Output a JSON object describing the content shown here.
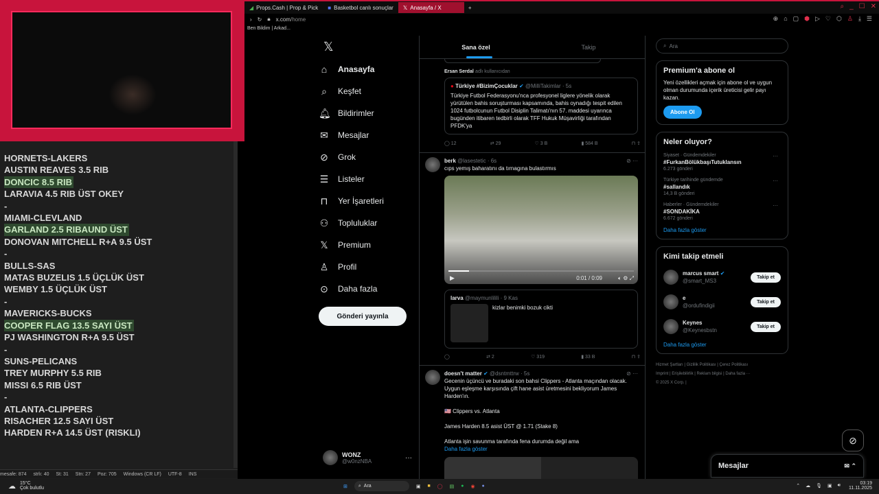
{
  "notes": {
    "lines": [
      {
        "text": "HORNETS-LAKERS",
        "hl": false
      },
      {
        "text": "AUSTIN REAVES 3.5 RIB",
        "hl": false
      },
      {
        "text": "DONCIC 8.5 RIB",
        "hl": true
      },
      {
        "text": "LARAVIA 4.5 RIB  ÜST OKEY",
        "hl": false
      },
      {
        "text": "-",
        "hl": false
      },
      {
        "text": "MIAMI-CLEVLAND",
        "hl": false
      },
      {
        "text": "GARLAND 2.5 RIBAUND ÜST",
        "hl": true
      },
      {
        "text": "DONOVAN MITCHELL R+A 9.5 ÜST",
        "hl": false
      },
      {
        "text": "-",
        "hl": false
      },
      {
        "text": "BULLS-SAS",
        "hl": false
      },
      {
        "text": "MATAS BUZELIS 1.5 ÜÇLÜK ÜST",
        "hl": false
      },
      {
        "text": "WEMBY 1.5 ÜÇLÜK ÜST",
        "hl": false
      },
      {
        "text": "-",
        "hl": false
      },
      {
        "text": "MAVERICKS-BUCKS",
        "hl": false
      },
      {
        "text": "COOPER FLAG 13.5 SAYI ÜST",
        "hl": true
      },
      {
        "text": "PJ WASHINGTON R+A 9.5 ÜST",
        "hl": false
      },
      {
        "text": "-",
        "hl": false
      },
      {
        "text": "SUNS-PELICANS",
        "hl": false
      },
      {
        "text": "TREY MURPHY 5.5 RIB",
        "hl": false
      },
      {
        "text": "MISSI 6.5 RIB ÜST",
        "hl": false
      },
      {
        "text": "-",
        "hl": false
      },
      {
        "text": "ATLANTA-CLIPPERS",
        "hl": false
      },
      {
        "text": "RISACHER 12.5 SAYI ÜST",
        "hl": false
      },
      {
        "text": "HARDEN R+A 14.5 ÜST (RISKLI)",
        "hl": false
      }
    ],
    "status": [
      "mesafe: 874",
      "strlı: 40",
      "St: 31",
      "Stn: 27",
      "Poz: 705",
      "Windows (CR LF)",
      "UTF-8",
      "INS"
    ]
  },
  "browser": {
    "tabs": [
      "Props.Cash | Prop & Pick",
      "Basketbol canlı sonuçlar",
      "Anasayfa / X"
    ],
    "url_host": "x.com",
    "url_path": "/home",
    "bookmarks": "Ben Bildim | Arkad..."
  },
  "nav": [
    {
      "icon": "home",
      "label": "Anasayfa"
    },
    {
      "icon": "search",
      "label": "Keşfet"
    },
    {
      "icon": "bell",
      "label": "Bildirimler"
    },
    {
      "icon": "mail",
      "label": "Mesajlar"
    },
    {
      "icon": "grok",
      "label": "Grok"
    },
    {
      "icon": "list",
      "label": "Listeler"
    },
    {
      "icon": "bookmark",
      "label": "Yer İşaretleri"
    },
    {
      "icon": "people",
      "label": "Topluluklar"
    },
    {
      "icon": "x",
      "label": "Premium"
    },
    {
      "icon": "person",
      "label": "Profil"
    },
    {
      "icon": "more",
      "label": "Daha fazla"
    }
  ],
  "post_button": "Gönderi yayınla",
  "me": {
    "name": "WONZ",
    "handle": "@w0nzNBA"
  },
  "feed": {
    "tabs": [
      "Sana özel",
      "Takip"
    ],
    "post1": {
      "repost_by": "Ersan Serdal",
      "repost_suffix": "adlı kullanıcıdan",
      "q_name": "Türkiye #BizimÇocuklar",
      "q_handle": "@MilliTakimlar · 5s",
      "q_text": "Türkiye Futbol Federasyonu'nca profesyonel liglere yönelik olarak yürütülen bahis soruşturması kapsamında, bahis oynadığı tespit edilen 1024 futbolcunun Futbol Disiplin Talimatı'nın 57. maddesi uyarınca bugünden itibaren tedbirli olarak TFF Hukuk Müşavirliği tarafından PFDK'ya",
      "replies": "12",
      "reposts": "29",
      "likes": "3 B",
      "views": "584 B"
    },
    "post2": {
      "name": "berk",
      "handle": "@lasestetic · 6s",
      "text": "cıps yemış baharatını da tırnagına bulastırmıs",
      "video_time": "0:01 / 0:09",
      "q_name": "larva",
      "q_handle": "@maymunlilili · 9 Kas",
      "q_text": "kizlar benimki bozuk cikti",
      "replies": "",
      "reposts": "2",
      "likes": "319",
      "views": "33 B"
    },
    "post3": {
      "name": "doesn't matter",
      "handle": "@dsntmttrw · 5s",
      "text": "Gecenin üçüncü ve buradaki son bahsi Clippers - Atlanta maçından olacak. Uygun eşleşme karşısında çift hane asist üretmesini bekliyorum James Harden'ın.",
      "line2": "🇺🇸 Clippers vs. Atlanta",
      "line3": "James Harden 8.5 asist ÜST @ 1.71 (Stake 8)",
      "line4": "Atlanta işin savunma tarafında fena durumda değil ama",
      "more": "Daha fazla göster"
    }
  },
  "right": {
    "search_placeholder": "Ara",
    "premium": {
      "title": "Premium'a abone ol",
      "text": "Yeni özellikleri açmak için abone ol ve uygun olman durumunda içerik üreticisi gelir payı kazan.",
      "button": "Abone Ol"
    },
    "trends": {
      "title": "Neler oluyor?",
      "items": [
        {
          "ctx": "Siyaset · Gündemdekiler",
          "tag": "#FurkanBölükbaşıTutuklansın",
          "count": "6.273 gönderi"
        },
        {
          "ctx": "Türkiye tarihinde gündemde",
          "tag": "#sallandık",
          "count": "14,3 B gönderi"
        },
        {
          "ctx": "Haberler · Gündemdekiler",
          "tag": "#SONDAKİKA",
          "count": "6.672 gönderi"
        }
      ],
      "more": "Daha fazla göster"
    },
    "follow": {
      "title": "Kimi takip etmeli",
      "items": [
        {
          "name": "marcus smart",
          "handle": "@smart_MS3",
          "verified": true
        },
        {
          "name": "e",
          "handle": "@ordufindigii",
          "verified": false
        },
        {
          "name": "Keynes",
          "handle": "@Keynesbstn",
          "verified": false
        }
      ],
      "button": "Takip et",
      "more": "Daha fazla göster"
    },
    "footer": [
      "Hizmet Şartları",
      "Gizlilik Politikası",
      "Çerez Politikası",
      "Imprint",
      "Erişilebilirlik",
      "Reklam bilgisi",
      "Daha fazla ···",
      "© 2025 X Corp."
    ]
  },
  "messages": "Mesajlar",
  "taskbar": {
    "temp": "15°C",
    "weather": "Çok bulutlu",
    "search": "Ara",
    "time": "03:19",
    "date": "11.11.2025"
  },
  "colors": {
    "accent": "#1d9bf0",
    "frame": "#c8143c",
    "highlight": "#2f4a2f"
  }
}
